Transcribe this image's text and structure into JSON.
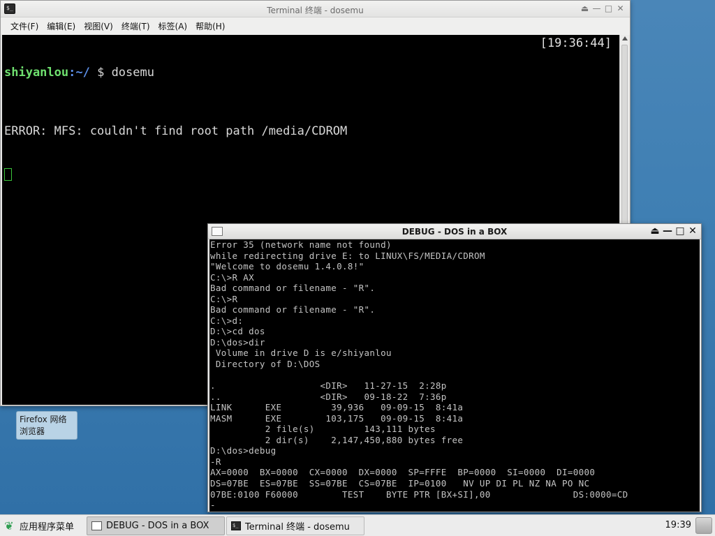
{
  "terminal": {
    "title": "Terminal 终端 - dosemu",
    "app_icon_glyph": "$_",
    "menus": [
      "文件(F)",
      "编辑(E)",
      "视图(V)",
      "终端(T)",
      "标签(A)",
      "帮助(H)"
    ],
    "prompt_user": "shiyanlou",
    "prompt_path": ":~/",
    "prompt_symbol": " $ ",
    "command": "dosemu",
    "clock": "[19:36:44]",
    "error_line": "ERROR: MFS: couldn't find root path /media/CDROM",
    "controls": [
      "⏏",
      "—",
      "□",
      "✕"
    ]
  },
  "launcher": {
    "label": "Firefox 网络浏览器"
  },
  "dosbox": {
    "title": "DEBUG - DOS in a BOX",
    "controls": [
      "⏏",
      "—",
      "□",
      "✕"
    ],
    "lines": [
      "Error 35 (network name not found)",
      "while redirecting drive E: to LINUX\\FS/MEDIA/CDROM",
      "\"Welcome to dosemu 1.4.0.8!\"",
      "C:\\>R AX",
      "Bad command or filename - \"R\".",
      "C:\\>R",
      "Bad command or filename - \"R\".",
      "C:\\>d:",
      "D:\\>cd dos",
      "D:\\dos>dir",
      " Volume in drive D is e/shiyanlou",
      " Directory of D:\\DOS",
      "",
      ".                   <DIR>   11-27-15  2:28p",
      "..                  <DIR>   09-18-22  7:36p",
      "LINK      EXE         39,936   09-09-15  8:41a",
      "MASM      EXE        103,175   09-09-15  8:41a",
      "          2 file(s)         143,111 bytes",
      "          2 dir(s)    2,147,450,880 bytes free",
      "D:\\dos>debug",
      "-R",
      "AX=0000  BX=0000  CX=0000  DX=0000  SP=FFFE  BP=0000  SI=0000  DI=0000",
      "DS=07BE  ES=07BE  SS=07BE  CS=07BE  IP=0100   NV UP DI PL NZ NA PO NC",
      "07BE:0100 F60000        TEST    BYTE PTR [BX+SI],00               DS:0000=CD",
      "-"
    ]
  },
  "taskbar": {
    "start_label": "应用程序菜单",
    "tasks": [
      {
        "label": "DEBUG - DOS in a BOX",
        "active": true
      },
      {
        "label": "Terminal 终端 - dosemu",
        "active": false
      }
    ],
    "clock": "19:39"
  },
  "colors": {
    "desktop": "#3f7fb3",
    "terminal_bg": "#000000",
    "prompt_user": "#6fe06f",
    "prompt_path": "#5c8fe8",
    "dos_text": "#c4c4c4"
  }
}
